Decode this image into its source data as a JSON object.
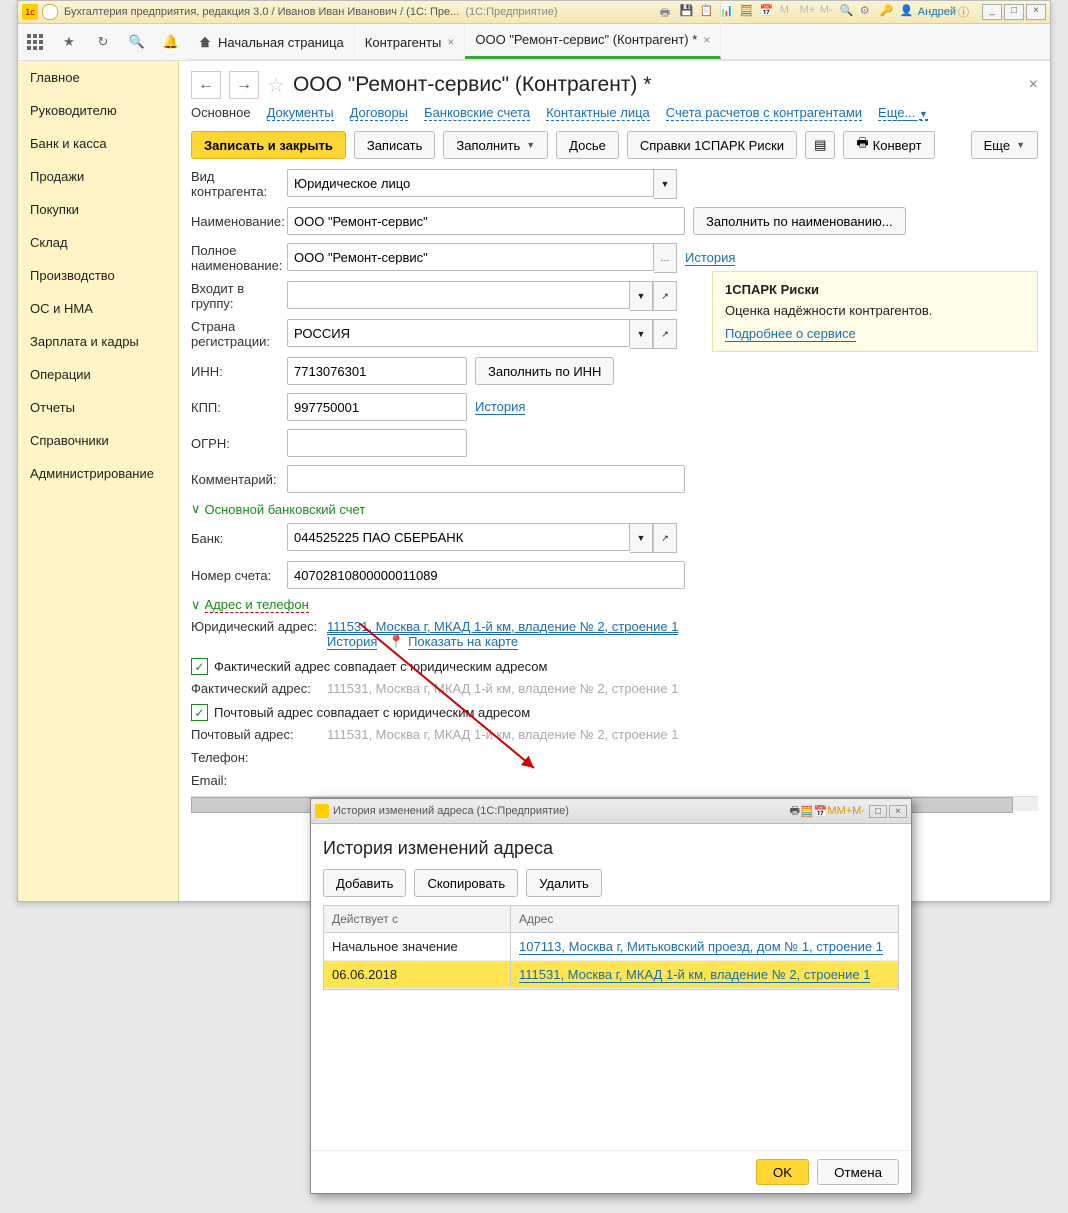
{
  "titlebar": {
    "text": "Бухгалтерия предприятия, редакция 3.0 / Иванов Иван Иванович / (1С: Пре...",
    "suffix": "(1С:Предприятие)",
    "user": "Андрей",
    "m": "M",
    "m_plus": "M+",
    "m_minus": "M-"
  },
  "tabs": {
    "home": "Начальная страница",
    "t1": "Контрагенты",
    "t2": "ООО \"Ремонт-сервис\" (Контрагент) *"
  },
  "sidebar": [
    "Главное",
    "Руководителю",
    "Банк и касса",
    "Продажи",
    "Покупки",
    "Склад",
    "Производство",
    "ОС и НМА",
    "Зарплата и кадры",
    "Операции",
    "Отчеты",
    "Справочники",
    "Администрирование"
  ],
  "page": {
    "title": "ООО \"Ремонт-сервис\" (Контрагент) *"
  },
  "subnav": {
    "main": "Основное",
    "docs": "Документы",
    "contracts": "Договоры",
    "accounts": "Банковские счета",
    "contacts": "Контактные лица",
    "settlements": "Счета расчетов с контрагентами",
    "more": "Еще..."
  },
  "buttons": {
    "save_close": "Записать и закрыть",
    "save": "Записать",
    "fill": "Заполнить",
    "dossier": "Досье",
    "spark": "Справки 1СПАРК Риски",
    "envelope": "Конверт",
    "more": "Еще"
  },
  "labels": {
    "kind": "Вид контрагента:",
    "name": "Наименование:",
    "fullname": "Полное наименование:",
    "group": "Входит в группу:",
    "country": "Страна регистрации:",
    "inn": "ИНН:",
    "kpp": "КПП:",
    "ogrn": "ОГРН:",
    "comment": "Комментарий:",
    "bank_section": "Основной банковский счет",
    "bank": "Банк:",
    "account_no": "Номер счета:",
    "address_section": "Адрес и телефон",
    "legal_addr": "Юридический адрес:",
    "fact_addr": "Фактический адрес:",
    "post_addr": "Почтовый адрес:",
    "phone": "Телефон:",
    "email": "Email:",
    "history": "История",
    "show_map": "Показать на карте",
    "fill_by_name": "Заполнить по наименованию...",
    "fill_by_inn": "Заполнить по ИНН",
    "check_fact": "Фактический адрес совпадает с юридическим адресом",
    "check_post": "Почтовый адрес совпадает с юридическим адресом"
  },
  "values": {
    "kind": "Юридическое лицо",
    "name": "ООО \"Ремонт-сервис\"",
    "fullname": "ООО \"Ремонт-сервис\"",
    "group": "",
    "country": "РОССИЯ",
    "inn": "7713076301",
    "kpp": "997750001",
    "ogrn": "",
    "comment": "",
    "bank": "044525225 ПАО СБЕРБАНК",
    "account_no": "40702810800000011089",
    "legal_addr": "111531, Москва г, МКАД 1-й км, владение № 2, строение 1",
    "muted_addr": "111531, Москва г, МКАД 1-й км, владение № 2, строение 1"
  },
  "spark_panel": {
    "title": "1СПАРК Риски",
    "text": "Оценка надёжности контрагентов.",
    "link": "Подробнее о сервисе"
  },
  "dialog": {
    "wintitle": "История изменений адреса  (1С:Предприятие)",
    "title": "История изменений адреса",
    "add": "Добавить",
    "copy": "Скопировать",
    "del": "Удалить",
    "col1": "Действует с",
    "col2": "Адрес",
    "rows": [
      {
        "date": "Начальное значение",
        "addr": "107113, Москва г, Митьковский проезд, дом № 1, строение 1"
      },
      {
        "date": "06.06.2018",
        "addr": "111531, Москва г, МКАД 1-й км, владение № 2, строение 1"
      }
    ],
    "ok": "OK",
    "cancel": "Отмена",
    "m": "M",
    "m_plus": "M+",
    "m_minus": "M-"
  }
}
